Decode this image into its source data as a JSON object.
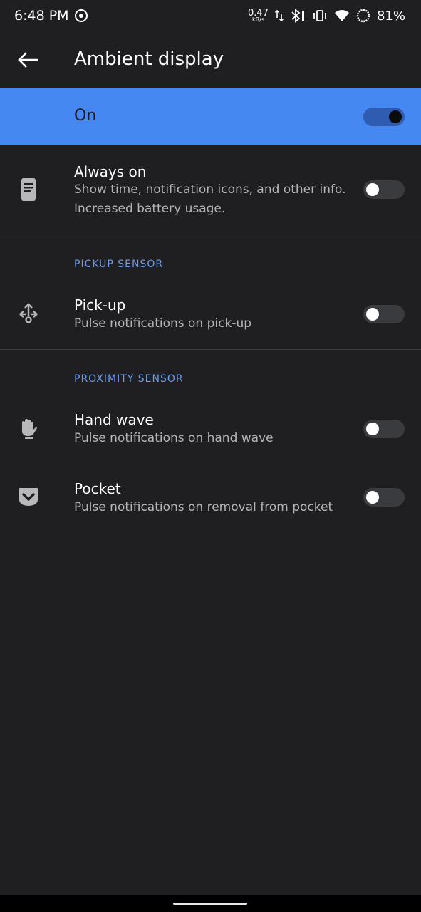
{
  "status_bar": {
    "time": "6:48 PM",
    "net_speed_value": "0.47",
    "net_speed_unit": "kB/s",
    "battery": "81%",
    "icons": [
      "media-icon",
      "data-arrows-icon",
      "bluetooth-icon",
      "vibrate-icon",
      "wifi-icon",
      "battery-saver-icon"
    ]
  },
  "app_bar": {
    "title": "Ambient display",
    "back_icon": "arrow-left-icon"
  },
  "master_switch": {
    "label": "On",
    "checked": true,
    "background": "#4688f1"
  },
  "settings": {
    "always_on": {
      "title": "Always on",
      "summary": "Show time, notification icons, and other info. Increased battery usage.",
      "icon": "phone-screen-icon",
      "checked": false
    },
    "pickup_header": "PICKUP SENSOR",
    "pickup": {
      "title": "Pick-up",
      "summary": "Pulse notifications on pick-up",
      "icon": "pickup-gesture-icon",
      "checked": false
    },
    "proximity_header": "PROXIMITY SENSOR",
    "hand_wave": {
      "title": "Hand wave",
      "summary": "Pulse notifications on hand wave",
      "icon": "hand-icon",
      "checked": false
    },
    "pocket": {
      "title": "Pocket",
      "summary": "Pulse notifications on removal from pocket",
      "icon": "pocket-icon",
      "checked": false
    }
  },
  "colors": {
    "background": "#1f1f21",
    "accent": "#6a9df0",
    "summary_text": "#b5b5b8"
  }
}
